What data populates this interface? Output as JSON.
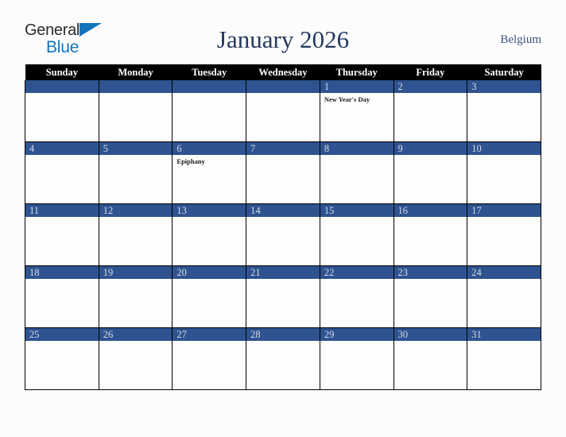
{
  "brand": {
    "name_part1": "General",
    "name_part2": "Blue",
    "triangle_color": "#1274bc"
  },
  "header": {
    "title": "January 2026",
    "country": "Belgium",
    "title_color": "#24385f"
  },
  "calendar": {
    "weekday_headers": [
      "Sunday",
      "Monday",
      "Tuesday",
      "Wednesday",
      "Thursday",
      "Friday",
      "Saturday"
    ],
    "header_bg": "#000000",
    "daynum_bg": "#2e5390",
    "daynum_color": "#d8dde8",
    "weeks": [
      [
        {
          "day": "",
          "events": []
        },
        {
          "day": "",
          "events": []
        },
        {
          "day": "",
          "events": []
        },
        {
          "day": "",
          "events": []
        },
        {
          "day": "1",
          "events": [
            "New Year's Day"
          ]
        },
        {
          "day": "2",
          "events": []
        },
        {
          "day": "3",
          "events": []
        }
      ],
      [
        {
          "day": "4",
          "events": []
        },
        {
          "day": "5",
          "events": []
        },
        {
          "day": "6",
          "events": [
            "Epiphany"
          ]
        },
        {
          "day": "7",
          "events": []
        },
        {
          "day": "8",
          "events": []
        },
        {
          "day": "9",
          "events": []
        },
        {
          "day": "10",
          "events": []
        }
      ],
      [
        {
          "day": "11",
          "events": []
        },
        {
          "day": "12",
          "events": []
        },
        {
          "day": "13",
          "events": []
        },
        {
          "day": "14",
          "events": []
        },
        {
          "day": "15",
          "events": []
        },
        {
          "day": "16",
          "events": []
        },
        {
          "day": "17",
          "events": []
        }
      ],
      [
        {
          "day": "18",
          "events": []
        },
        {
          "day": "19",
          "events": []
        },
        {
          "day": "20",
          "events": []
        },
        {
          "day": "21",
          "events": []
        },
        {
          "day": "22",
          "events": []
        },
        {
          "day": "23",
          "events": []
        },
        {
          "day": "24",
          "events": []
        }
      ],
      [
        {
          "day": "25",
          "events": []
        },
        {
          "day": "26",
          "events": []
        },
        {
          "day": "27",
          "events": []
        },
        {
          "day": "28",
          "events": []
        },
        {
          "day": "29",
          "events": []
        },
        {
          "day": "30",
          "events": []
        },
        {
          "day": "31",
          "events": []
        }
      ]
    ]
  }
}
